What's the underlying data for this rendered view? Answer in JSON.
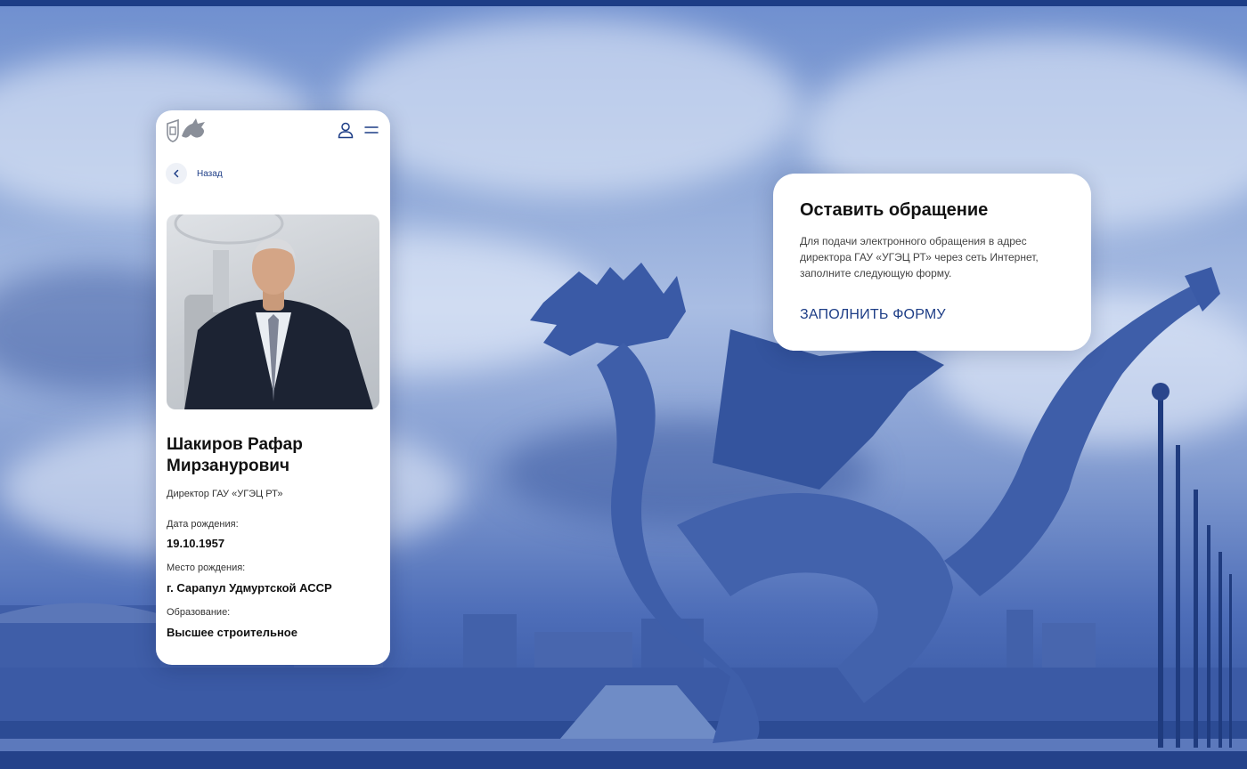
{
  "header": {
    "logo_icon": "dragon-crest-logo",
    "user_icon": "user-icon",
    "menu_icon": "menu-icon"
  },
  "back": {
    "label": "Назад"
  },
  "person": {
    "name": "Шакиров Рафар Мирзанурович",
    "role": "Директор ГАУ «УГЭЦ РТ»",
    "fields": [
      {
        "label": "Дата рождения:",
        "value": "19.10.1957"
      },
      {
        "label": "Место рождения:",
        "value": "г. Сарапул Удмуртской АССР"
      },
      {
        "label": "Образование:",
        "value": "Высшее строительное"
      }
    ]
  },
  "appeal": {
    "title": "Оставить обращение",
    "text": "Для подачи электронного обращения в адрес директора ГАУ «УГЭЦ РТ» через сеть Интернет, заполните следующую форму.",
    "link": "ЗАПОЛНИТЬ ФОРМУ"
  },
  "colors": {
    "accent": "#1d3d86",
    "background_tint": "#3d5fae",
    "card": "#ffffff"
  }
}
